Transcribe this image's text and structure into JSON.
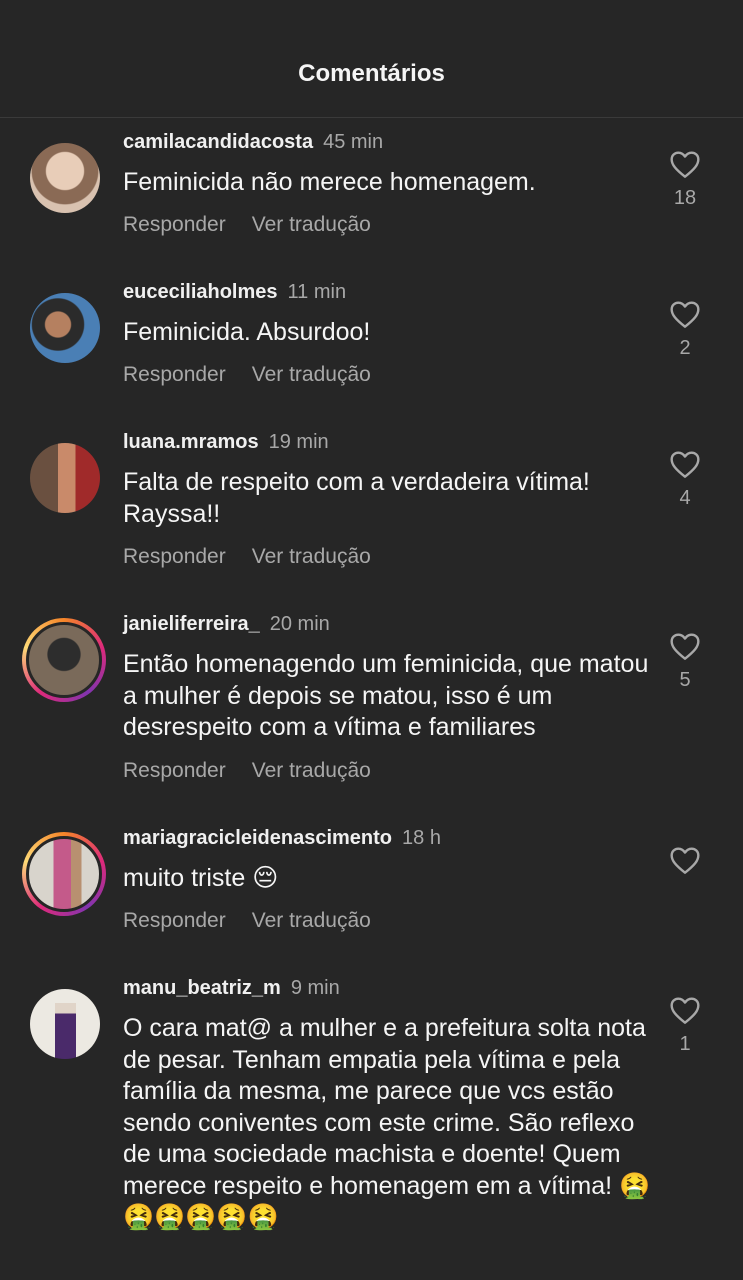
{
  "header": {
    "title": "Comentários"
  },
  "comments": [
    {
      "username": "camilacandidacosta",
      "time": "45 min",
      "text": "Feminicida não merece homenagem.",
      "reply_label": "Responder",
      "translate_label": "Ver tradução",
      "likes": "18",
      "avatar_colors": [
        "#d9c2b0",
        "#8a6a55"
      ]
    },
    {
      "username": "euceciliaholmes",
      "time": "11 min",
      "text": "Feminicida. Absurdoo!",
      "reply_label": "Responder",
      "translate_label": "Ver tradução",
      "likes": "2",
      "avatar_colors": [
        "#4a7fb5",
        "#2b2b2b"
      ]
    },
    {
      "username": "luana.mramos",
      "time": "19 min",
      "text": "Falta de respeito com a verdadeira vítima! Rayssa!!",
      "reply_label": "Responder",
      "translate_label": "Ver tradução",
      "likes": "4",
      "avatar_colors": [
        "#c98a6a",
        "#a02a2a"
      ]
    },
    {
      "username": "janieliferreira_",
      "time": "20 min",
      "text": "Então homenagendo um feminicida, que matou a mulher é depois se matou, isso é um desrespeito com a vítima e familiares",
      "reply_label": "Responder",
      "translate_label": "Ver tradução",
      "likes": "5",
      "avatar_colors": [
        "#7a6a5a",
        "#2d2d2d"
      ]
    },
    {
      "username": "mariagracicleidenascimento",
      "time": "18 h",
      "text": "muito triste 😔",
      "reply_label": "Responder",
      "translate_label": "Ver tradução",
      "likes": "",
      "avatar_colors": [
        "#d8d4cc",
        "#c45a8a"
      ]
    },
    {
      "username": "manu_beatriz_m",
      "time": "9 min",
      "text": "O cara mat@ a mulher e a prefeitura solta nota de pesar. Tenham empatia pela vítima e pela família da mesma, me parece que vcs estão sendo coniventes com este crime. São reflexo de uma sociedade machista e doente! Quem merece respeito e homenagem em a vítima! 🤮🤮🤮🤮🤮🤮",
      "reply_label": "",
      "translate_label": "",
      "likes": "1",
      "avatar_colors": [
        "#ece9e2",
        "#4a2a6a"
      ]
    }
  ]
}
